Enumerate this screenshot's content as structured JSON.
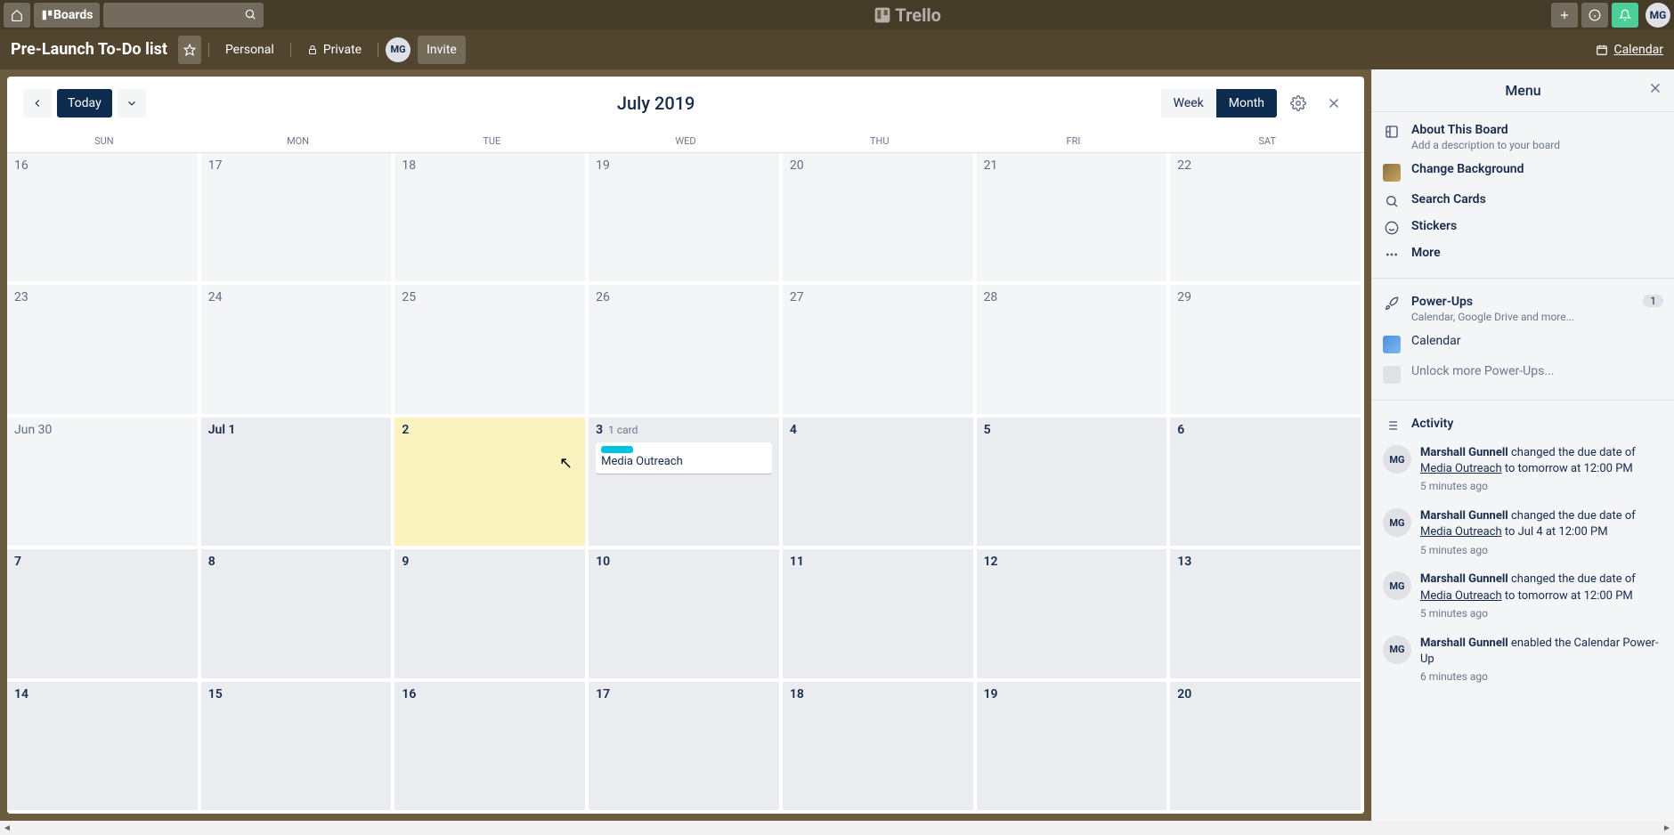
{
  "topbar": {
    "boards_label": "Boards",
    "logo_text": "Trello",
    "avatar": "MG"
  },
  "boardbar": {
    "title": "Pre-Launch To-Do list",
    "personal": "Personal",
    "private": "Private",
    "member_avatar": "MG",
    "invite": "Invite",
    "calendar_link": "Calendar"
  },
  "calendar": {
    "today_label": "Today",
    "title": "July 2019",
    "week_label": "Week",
    "month_label": "Month",
    "dow": [
      "SUN",
      "MON",
      "TUE",
      "WED",
      "THU",
      "FRI",
      "SAT"
    ],
    "weeks": [
      [
        {
          "label": "16",
          "in_month": false
        },
        {
          "label": "17",
          "in_month": false
        },
        {
          "label": "18",
          "in_month": false
        },
        {
          "label": "19",
          "in_month": false
        },
        {
          "label": "20",
          "in_month": false
        },
        {
          "label": "21",
          "in_month": false
        },
        {
          "label": "22",
          "in_month": false
        }
      ],
      [
        {
          "label": "23",
          "in_month": false
        },
        {
          "label": "24",
          "in_month": false
        },
        {
          "label": "25",
          "in_month": false
        },
        {
          "label": "26",
          "in_month": false
        },
        {
          "label": "27",
          "in_month": false
        },
        {
          "label": "28",
          "in_month": false
        },
        {
          "label": "29",
          "in_month": false
        }
      ],
      [
        {
          "label": "Jun 30",
          "in_month": false
        },
        {
          "label": "Jul 1",
          "in_month": true
        },
        {
          "label": "2",
          "in_month": true,
          "today": true
        },
        {
          "label": "3",
          "in_month": true,
          "card_count": "1 card",
          "cards": [
            {
              "label_color": "#00c2e0",
              "title": "Media Outreach"
            }
          ]
        },
        {
          "label": "4",
          "in_month": true
        },
        {
          "label": "5",
          "in_month": true
        },
        {
          "label": "6",
          "in_month": true
        }
      ],
      [
        {
          "label": "7",
          "in_month": true
        },
        {
          "label": "8",
          "in_month": true
        },
        {
          "label": "9",
          "in_month": true
        },
        {
          "label": "10",
          "in_month": true
        },
        {
          "label": "11",
          "in_month": true
        },
        {
          "label": "12",
          "in_month": true
        },
        {
          "label": "13",
          "in_month": true
        }
      ],
      [
        {
          "label": "14",
          "in_month": true
        },
        {
          "label": "15",
          "in_month": true
        },
        {
          "label": "16",
          "in_month": true
        },
        {
          "label": "17",
          "in_month": true
        },
        {
          "label": "18",
          "in_month": true
        },
        {
          "label": "19",
          "in_month": true
        },
        {
          "label": "20",
          "in_month": true
        }
      ]
    ]
  },
  "sidebar": {
    "title": "Menu",
    "about_title": "About This Board",
    "about_sub": "Add a description to your board",
    "change_bg": "Change Background",
    "search_cards": "Search Cards",
    "stickers": "Stickers",
    "more": "More",
    "powerups_title": "Power-Ups",
    "powerups_sub": "Calendar, Google Drive and more...",
    "powerups_badge": "1",
    "calendar_item": "Calendar",
    "unlock": "Unlock more Power-Ups...",
    "activity_title": "Activity",
    "activity": [
      {
        "avatar": "MG",
        "user": "Marshall Gunnell",
        "before": " changed the due date of ",
        "link": "Media Outreach",
        "after": " to tomorrow at 12:00 PM",
        "time": "5 minutes ago"
      },
      {
        "avatar": "MG",
        "user": "Marshall Gunnell",
        "before": " changed the due date of ",
        "link": "Media Outreach",
        "after": " to Jul 4 at 12:00 PM",
        "time": "5 minutes ago"
      },
      {
        "avatar": "MG",
        "user": "Marshall Gunnell",
        "before": " changed the due date of ",
        "link": "Media Outreach",
        "after": " to tomorrow at 12:00 PM",
        "time": "5 minutes ago"
      },
      {
        "avatar": "MG",
        "user": "Marshall Gunnell",
        "before": " enabled the Calendar Power-Up",
        "link": "",
        "after": "",
        "time": "6 minutes ago"
      }
    ]
  }
}
